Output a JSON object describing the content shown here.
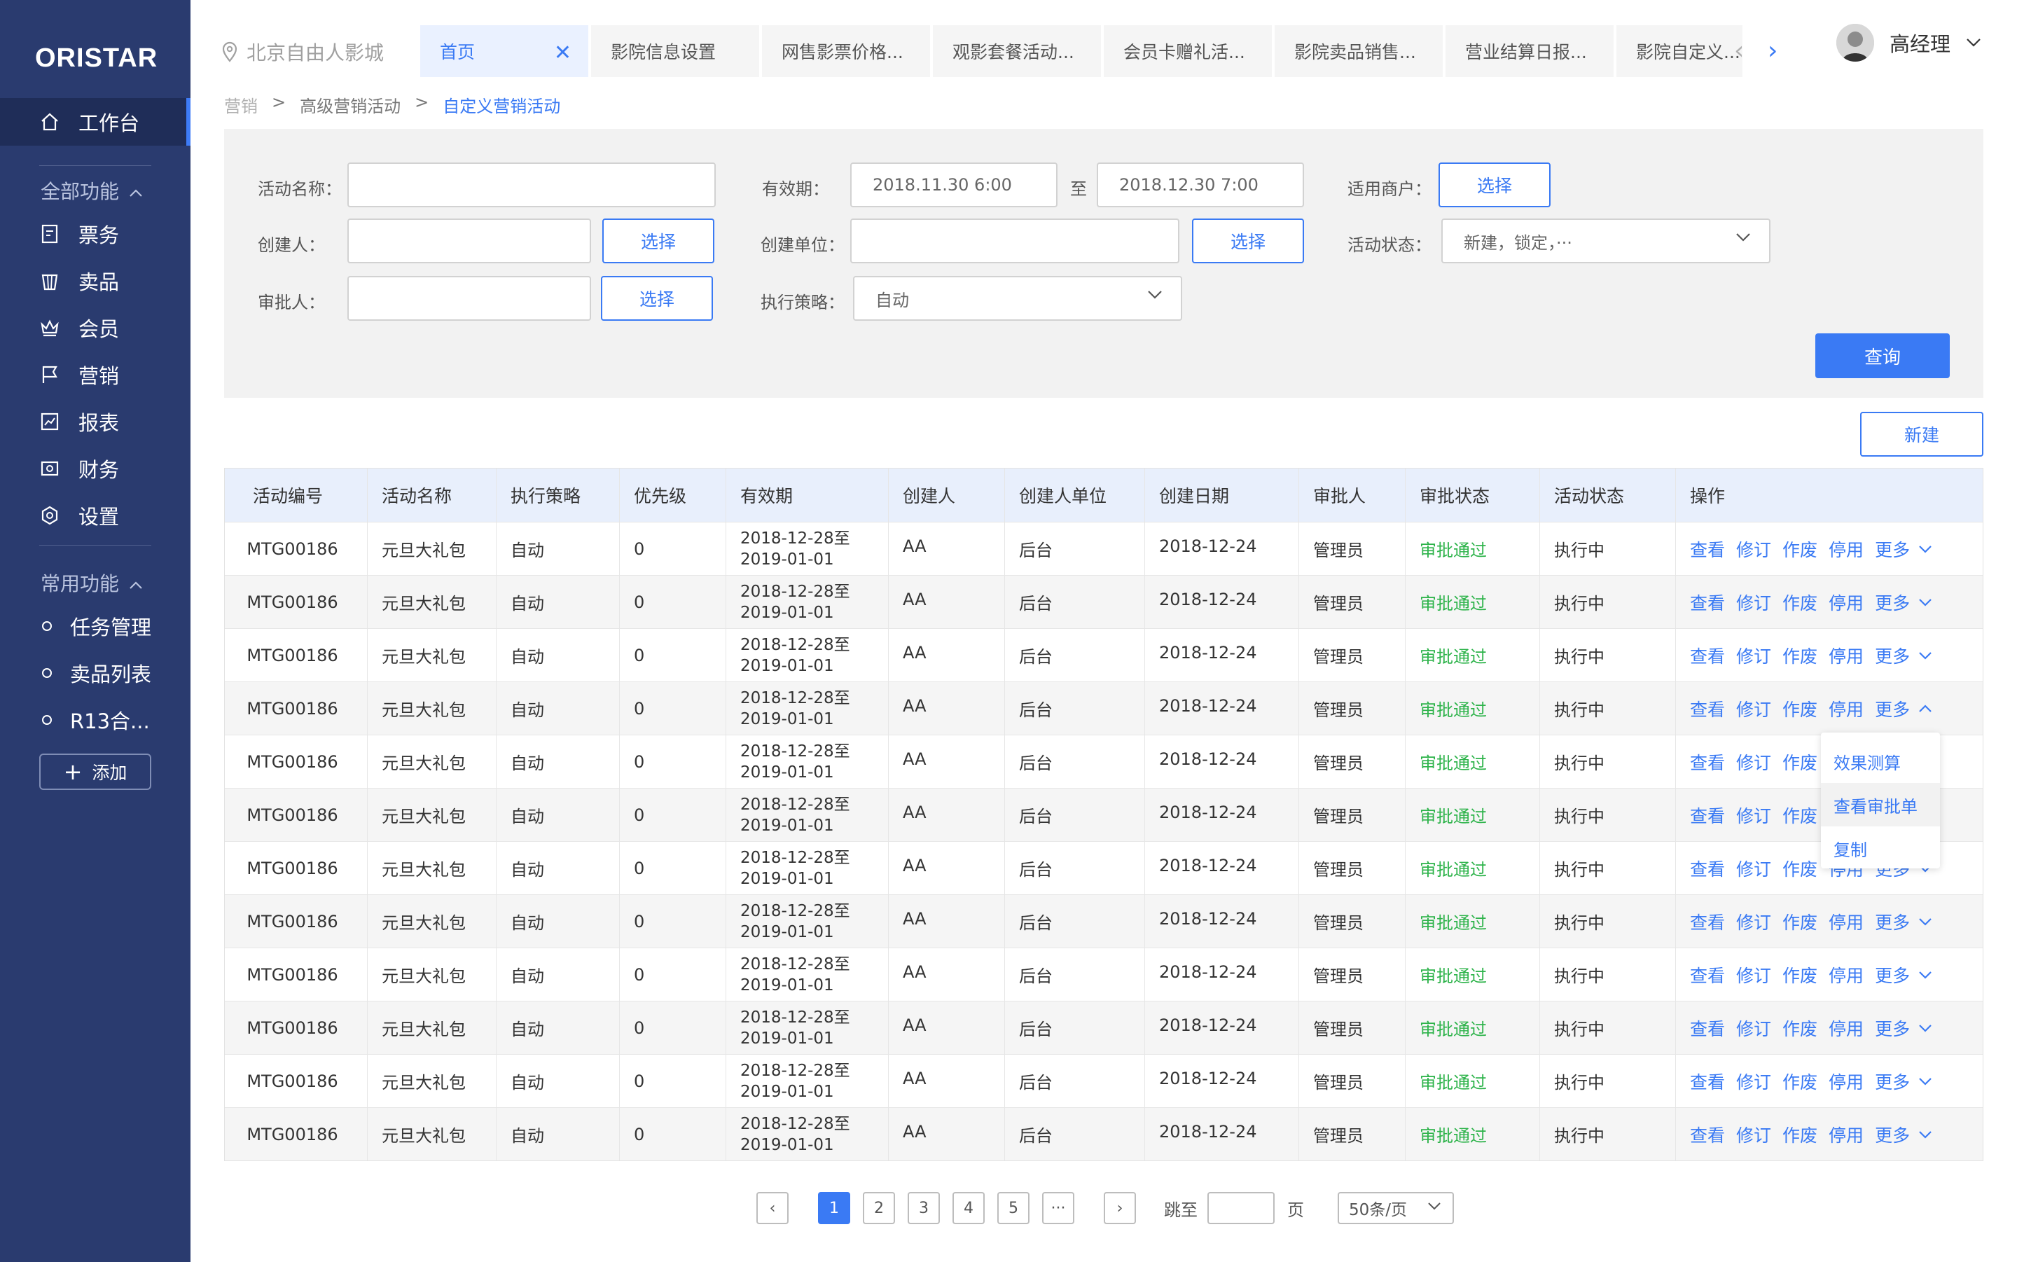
{
  "app": {
    "logo": "ORISTAR"
  },
  "sidebar": {
    "workbench": "工作台",
    "all_functions": "全部功能",
    "items": [
      {
        "label": "票务",
        "icon": "ticket-icon"
      },
      {
        "label": "卖品",
        "icon": "bucket-icon"
      },
      {
        "label": "会员",
        "icon": "crown-icon"
      },
      {
        "label": "营销",
        "icon": "flag-icon"
      },
      {
        "label": "报表",
        "icon": "chart-icon"
      },
      {
        "label": "财务",
        "icon": "finance-icon"
      },
      {
        "label": "设置",
        "icon": "gear-icon"
      }
    ],
    "common_functions": "常用功能",
    "common_items": [
      {
        "label": "任务管理"
      },
      {
        "label": "卖品列表"
      },
      {
        "label": "R13合..."
      }
    ],
    "add_label": "添加"
  },
  "header": {
    "location": "北京自由人影城",
    "tabs": [
      {
        "label": "首页",
        "active": true
      },
      {
        "label": "影院信息设置"
      },
      {
        "label": "网售影票价格..."
      },
      {
        "label": "观影套餐活动..."
      },
      {
        "label": "会员卡赠礼活..."
      },
      {
        "label": "影院卖品销售..."
      },
      {
        "label": "营业结算日报..."
      },
      {
        "label": "影院自定义..."
      }
    ],
    "user_name": "高经理"
  },
  "breadcrumb": [
    "营销",
    "高级营销活动",
    "自定义营销活动"
  ],
  "filter": {
    "activity_name_label": "活动名称：",
    "validity_label": "有效期：",
    "date_start": "2018.11.30 6:00",
    "date_sep": "至",
    "date_end": "2018.12.30 7:00",
    "merchant_label": "适用商户：",
    "creator_label": "创建人：",
    "creator_unit_label": "创建单位：",
    "activity_status_label": "活动状态：",
    "activity_status_value": "新建，锁定，···",
    "approver_label": "审批人：",
    "strategy_label": "执行策略：",
    "strategy_value": "自动",
    "select_label": "选择",
    "query_label": "查询"
  },
  "new_label": "新建",
  "table": {
    "columns": [
      "活动编号",
      "活动名称",
      "执行策略",
      "优先级",
      "有效期",
      "创建人",
      "创建人单位",
      "创建日期",
      "审批人",
      "审批状态",
      "活动状态",
      "操作"
    ],
    "rows": [
      {
        "code": "MTG00186",
        "name": "元旦大礼包",
        "strategy": "自动",
        "priority": "0",
        "valid_from": "2018-12-28至",
        "valid_to": "2019-01-01",
        "creator": "AA",
        "unit": "后台",
        "date": "2018-12-24",
        "approver": "管理员",
        "approval": "审批通过",
        "status": "执行中"
      },
      {
        "code": "MTG00186",
        "name": "元旦大礼包",
        "strategy": "自动",
        "priority": "0",
        "valid_from": "2018-12-28至",
        "valid_to": "2019-01-01",
        "creator": "AA",
        "unit": "后台",
        "date": "2018-12-24",
        "approver": "管理员",
        "approval": "审批通过",
        "status": "执行中"
      },
      {
        "code": "MTG00186",
        "name": "元旦大礼包",
        "strategy": "自动",
        "priority": "0",
        "valid_from": "2018-12-28至",
        "valid_to": "2019-01-01",
        "creator": "AA",
        "unit": "后台",
        "date": "2018-12-24",
        "approver": "管理员",
        "approval": "审批通过",
        "status": "执行中"
      },
      {
        "code": "MTG00186",
        "name": "元旦大礼包",
        "strategy": "自动",
        "priority": "0",
        "valid_from": "2018-12-28至",
        "valid_to": "2019-01-01",
        "creator": "AA",
        "unit": "后台",
        "date": "2018-12-24",
        "approver": "管理员",
        "approval": "审批通过",
        "status": "执行中"
      },
      {
        "code": "MTG00186",
        "name": "元旦大礼包",
        "strategy": "自动",
        "priority": "0",
        "valid_from": "2018-12-28至",
        "valid_to": "2019-01-01",
        "creator": "AA",
        "unit": "后台",
        "date": "2018-12-24",
        "approver": "管理员",
        "approval": "审批通过",
        "status": "执行中"
      },
      {
        "code": "MTG00186",
        "name": "元旦大礼包",
        "strategy": "自动",
        "priority": "0",
        "valid_from": "2018-12-28至",
        "valid_to": "2019-01-01",
        "creator": "AA",
        "unit": "后台",
        "date": "2018-12-24",
        "approver": "管理员",
        "approval": "审批通过",
        "status": "执行中"
      },
      {
        "code": "MTG00186",
        "name": "元旦大礼包",
        "strategy": "自动",
        "priority": "0",
        "valid_from": "2018-12-28至",
        "valid_to": "2019-01-01",
        "creator": "AA",
        "unit": "后台",
        "date": "2018-12-24",
        "approver": "管理员",
        "approval": "审批通过",
        "status": "执行中"
      },
      {
        "code": "MTG00186",
        "name": "元旦大礼包",
        "strategy": "自动",
        "priority": "0",
        "valid_from": "2018-12-28至",
        "valid_to": "2019-01-01",
        "creator": "AA",
        "unit": "后台",
        "date": "2018-12-24",
        "approver": "管理员",
        "approval": "审批通过",
        "status": "执行中"
      },
      {
        "code": "MTG00186",
        "name": "元旦大礼包",
        "strategy": "自动",
        "priority": "0",
        "valid_from": "2018-12-28至",
        "valid_to": "2019-01-01",
        "creator": "AA",
        "unit": "后台",
        "date": "2018-12-24",
        "approver": "管理员",
        "approval": "审批通过",
        "status": "执行中"
      },
      {
        "code": "MTG00186",
        "name": "元旦大礼包",
        "strategy": "自动",
        "priority": "0",
        "valid_from": "2018-12-28至",
        "valid_to": "2019-01-01",
        "creator": "AA",
        "unit": "后台",
        "date": "2018-12-24",
        "approver": "管理员",
        "approval": "审批通过",
        "status": "执行中"
      },
      {
        "code": "MTG00186",
        "name": "元旦大礼包",
        "strategy": "自动",
        "priority": "0",
        "valid_from": "2018-12-28至",
        "valid_to": "2019-01-01",
        "creator": "AA",
        "unit": "后台",
        "date": "2018-12-24",
        "approver": "管理员",
        "approval": "审批通过",
        "status": "执行中"
      },
      {
        "code": "MTG00186",
        "name": "元旦大礼包",
        "strategy": "自动",
        "priority": "0",
        "valid_from": "2018-12-28至",
        "valid_to": "2019-01-01",
        "creator": "AA",
        "unit": "后台",
        "date": "2018-12-24",
        "approver": "管理员",
        "approval": "审批通过",
        "status": "执行中"
      }
    ],
    "ops": {
      "view": "查看",
      "revise": "修订",
      "void": "作废",
      "disable": "停用",
      "more": "更多"
    },
    "open_more_row": 3
  },
  "dropdown": {
    "items": [
      "效果测算",
      "查看审批单",
      "复制"
    ]
  },
  "pagination": {
    "prev": "‹",
    "pages": [
      "1",
      "2",
      "3",
      "4",
      "5",
      "···"
    ],
    "current": "1",
    "next": "›",
    "jump_label": "跳至",
    "page_label": "页",
    "page_size": "50条/页"
  },
  "colors": {
    "sidebar": "#2a3b6f",
    "accent": "#3a7af4",
    "success": "#2db34a",
    "header_row": "#e8effc"
  }
}
